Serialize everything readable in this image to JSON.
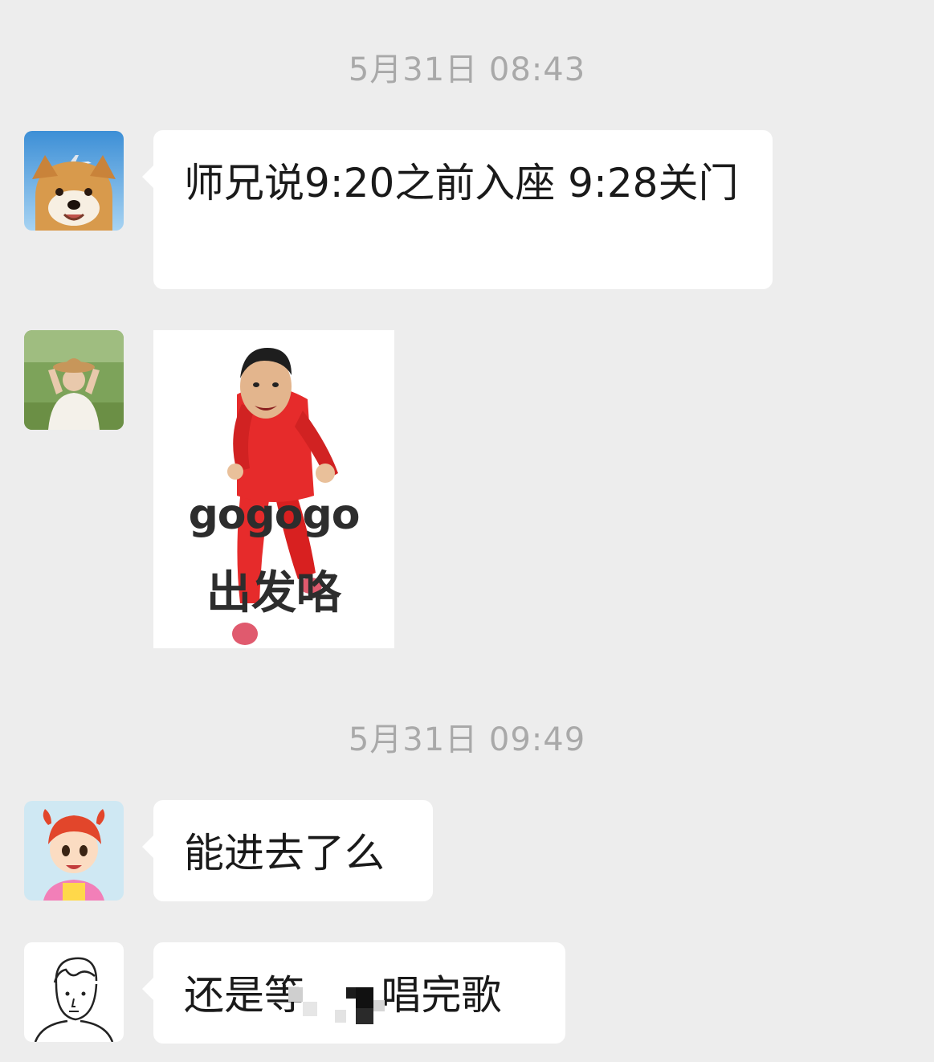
{
  "timestamps": [
    "5月31日 08:43",
    "5月31日 09:49"
  ],
  "messages": [
    {
      "type": "text",
      "text": "师兄说9:20之前入座 9:28关门"
    },
    {
      "type": "sticker",
      "line1": "gogogo",
      "line2": "出发咯"
    },
    {
      "type": "text",
      "text": "能进去了么"
    },
    {
      "type": "text",
      "text": "还是等      唱完歌"
    }
  ],
  "colors": {
    "background": "#ededed",
    "bubble": "#ffffff",
    "timestamp": "#a9a9a9",
    "sticker_suit": "#e62b2b"
  },
  "icons": [
    "dog-avatar-icon",
    "woman-hat-avatar-icon",
    "cartoon-girl-avatar-icon",
    "cartoon-boy-avatar-icon"
  ]
}
